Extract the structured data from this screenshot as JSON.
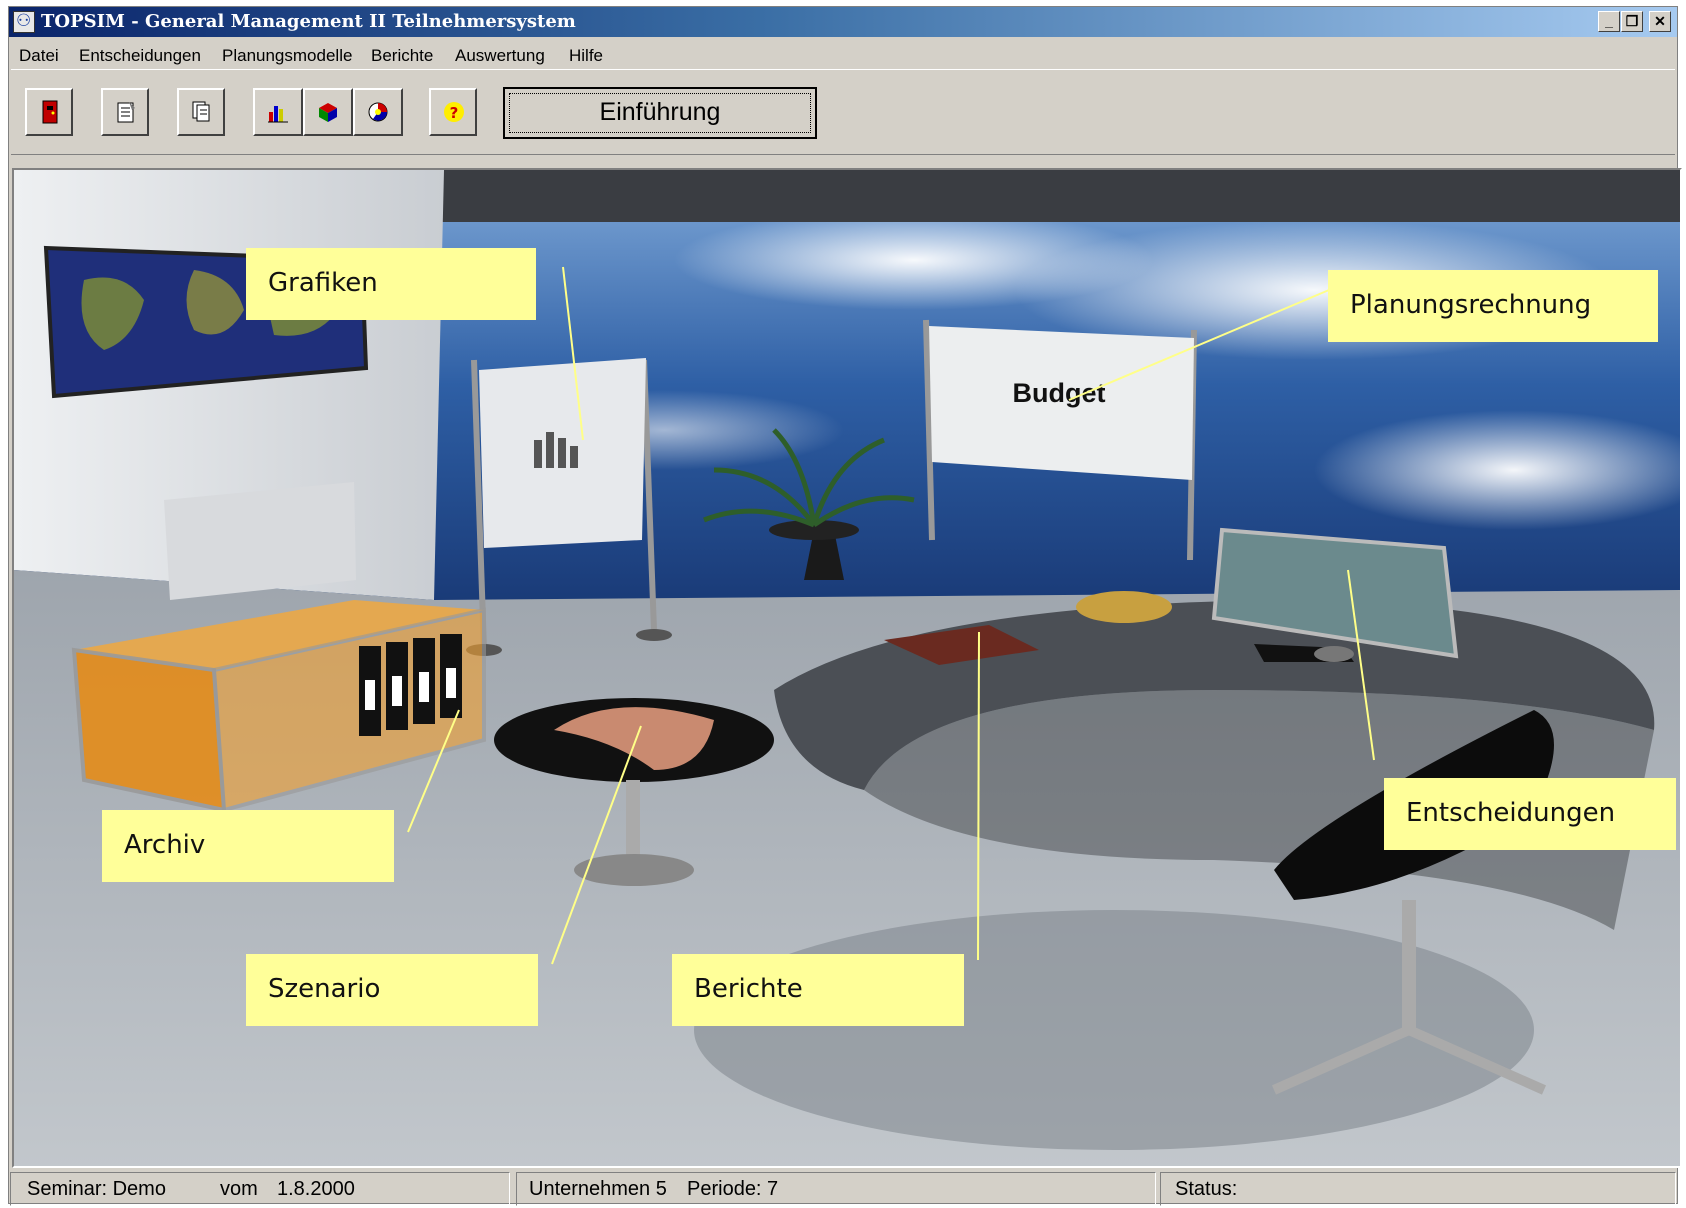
{
  "window": {
    "title": "TOPSIM - General Management II Teilnehmersystem",
    "controls": {
      "minimize": "_",
      "restore": "❐",
      "close": "✕"
    }
  },
  "menu": [
    "Datei",
    "Entscheidungen",
    "Planungsmodelle",
    "Berichte",
    "Auswertung",
    "Hilfe"
  ],
  "toolbar": {
    "icons": [
      "exit-door-icon",
      "notepad-icon",
      "documents-icon",
      "bar-chart-icon",
      "cube-chart-icon",
      "pie-chart-icon",
      "help-icon"
    ],
    "intro_label": "Einführung"
  },
  "scene": {
    "board_text": "Budget",
    "callouts": {
      "grafiken": "Grafiken",
      "planungsrechnung": "Planungsrechnung",
      "archiv": "Archiv",
      "szenario": "Szenario",
      "berichte": "Berichte",
      "entscheidungen": "Entscheidungen"
    }
  },
  "status": {
    "seminar": "Seminar: Demo",
    "vom": "vom",
    "date": "1.8.2000",
    "company": "Unternehmen 5",
    "period": "Periode: 7",
    "status_label": "Status:"
  },
  "colors": {
    "callout_bg": "#ffff99",
    "titlebar_start": "#0a246a",
    "titlebar_end": "#a6caf0",
    "chrome": "#d4d0c8"
  }
}
